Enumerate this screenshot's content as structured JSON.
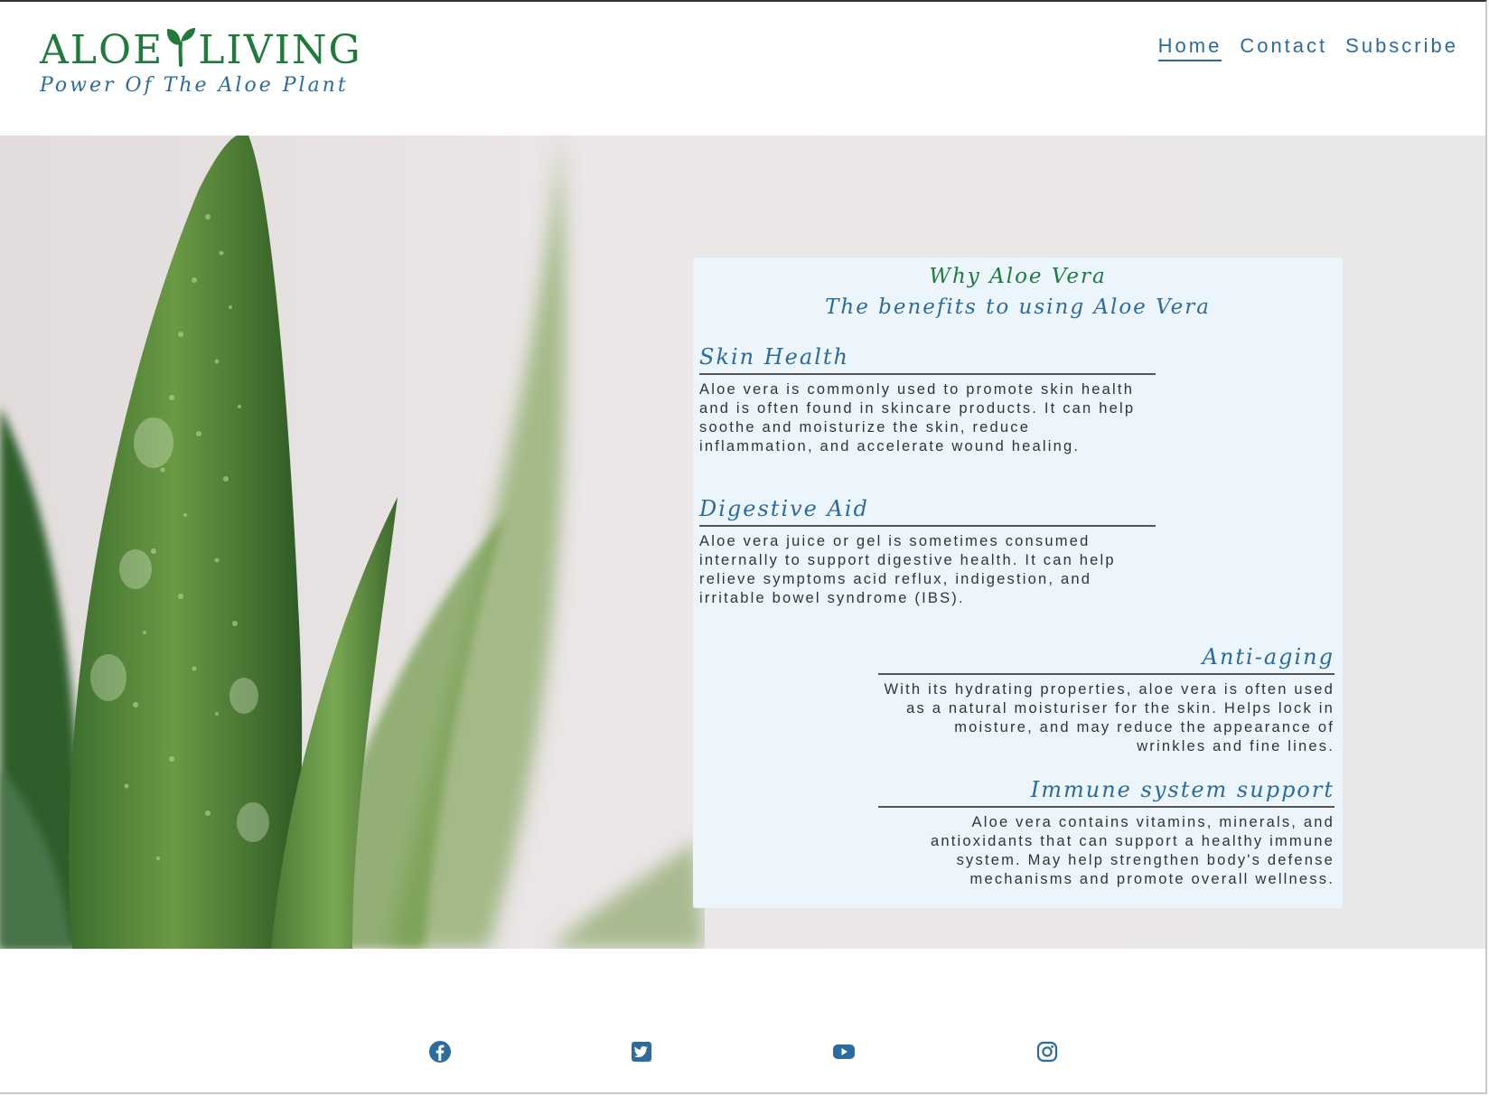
{
  "header": {
    "logo_left": "ALOE",
    "logo_right": "LIVING",
    "tagline": "Power Of The Aloe Plant",
    "nav": [
      {
        "label": "Home",
        "active": true
      },
      {
        "label": "Contact",
        "active": false
      },
      {
        "label": "Subscribe",
        "active": false
      }
    ]
  },
  "card": {
    "title": "Why Aloe Vera",
    "subtitle": "The benefits to using Aloe Vera",
    "sections": [
      {
        "heading": "Skin Health",
        "text": "Aloe vera is commonly used to promote skin health and is often found in skincare products. It can help soothe and moisturize the skin, reduce inflammation, and accelerate wound healing."
      },
      {
        "heading": "Digestive Aid",
        "text": "Aloe vera juice or gel is sometimes consumed internally to support digestive health. It can help relieve symptoms acid reflux, indigestion, and irritable bowel syndrome (IBS)."
      },
      {
        "heading": "Anti-aging",
        "text": "With its hydrating properties, aloe vera is often used as a natural moisturiser for the skin. Helps lock in moisture, and may reduce the appearance of wrinkles and fine lines."
      },
      {
        "heading": "Immune system support",
        "text": "Aloe vera contains vitamins, minerals, and antioxidants that can support a healthy immune system. May help strengthen body's defense mechanisms and promote overall wellness."
      }
    ]
  },
  "footer": {
    "social": [
      "facebook-icon",
      "twitter-icon",
      "youtube-icon",
      "instagram-icon"
    ]
  },
  "colors": {
    "brand_green": "#1f7a3c",
    "brand_blue": "#2b6b9e",
    "card_bg": "#edf5fc",
    "text": "#333333"
  }
}
